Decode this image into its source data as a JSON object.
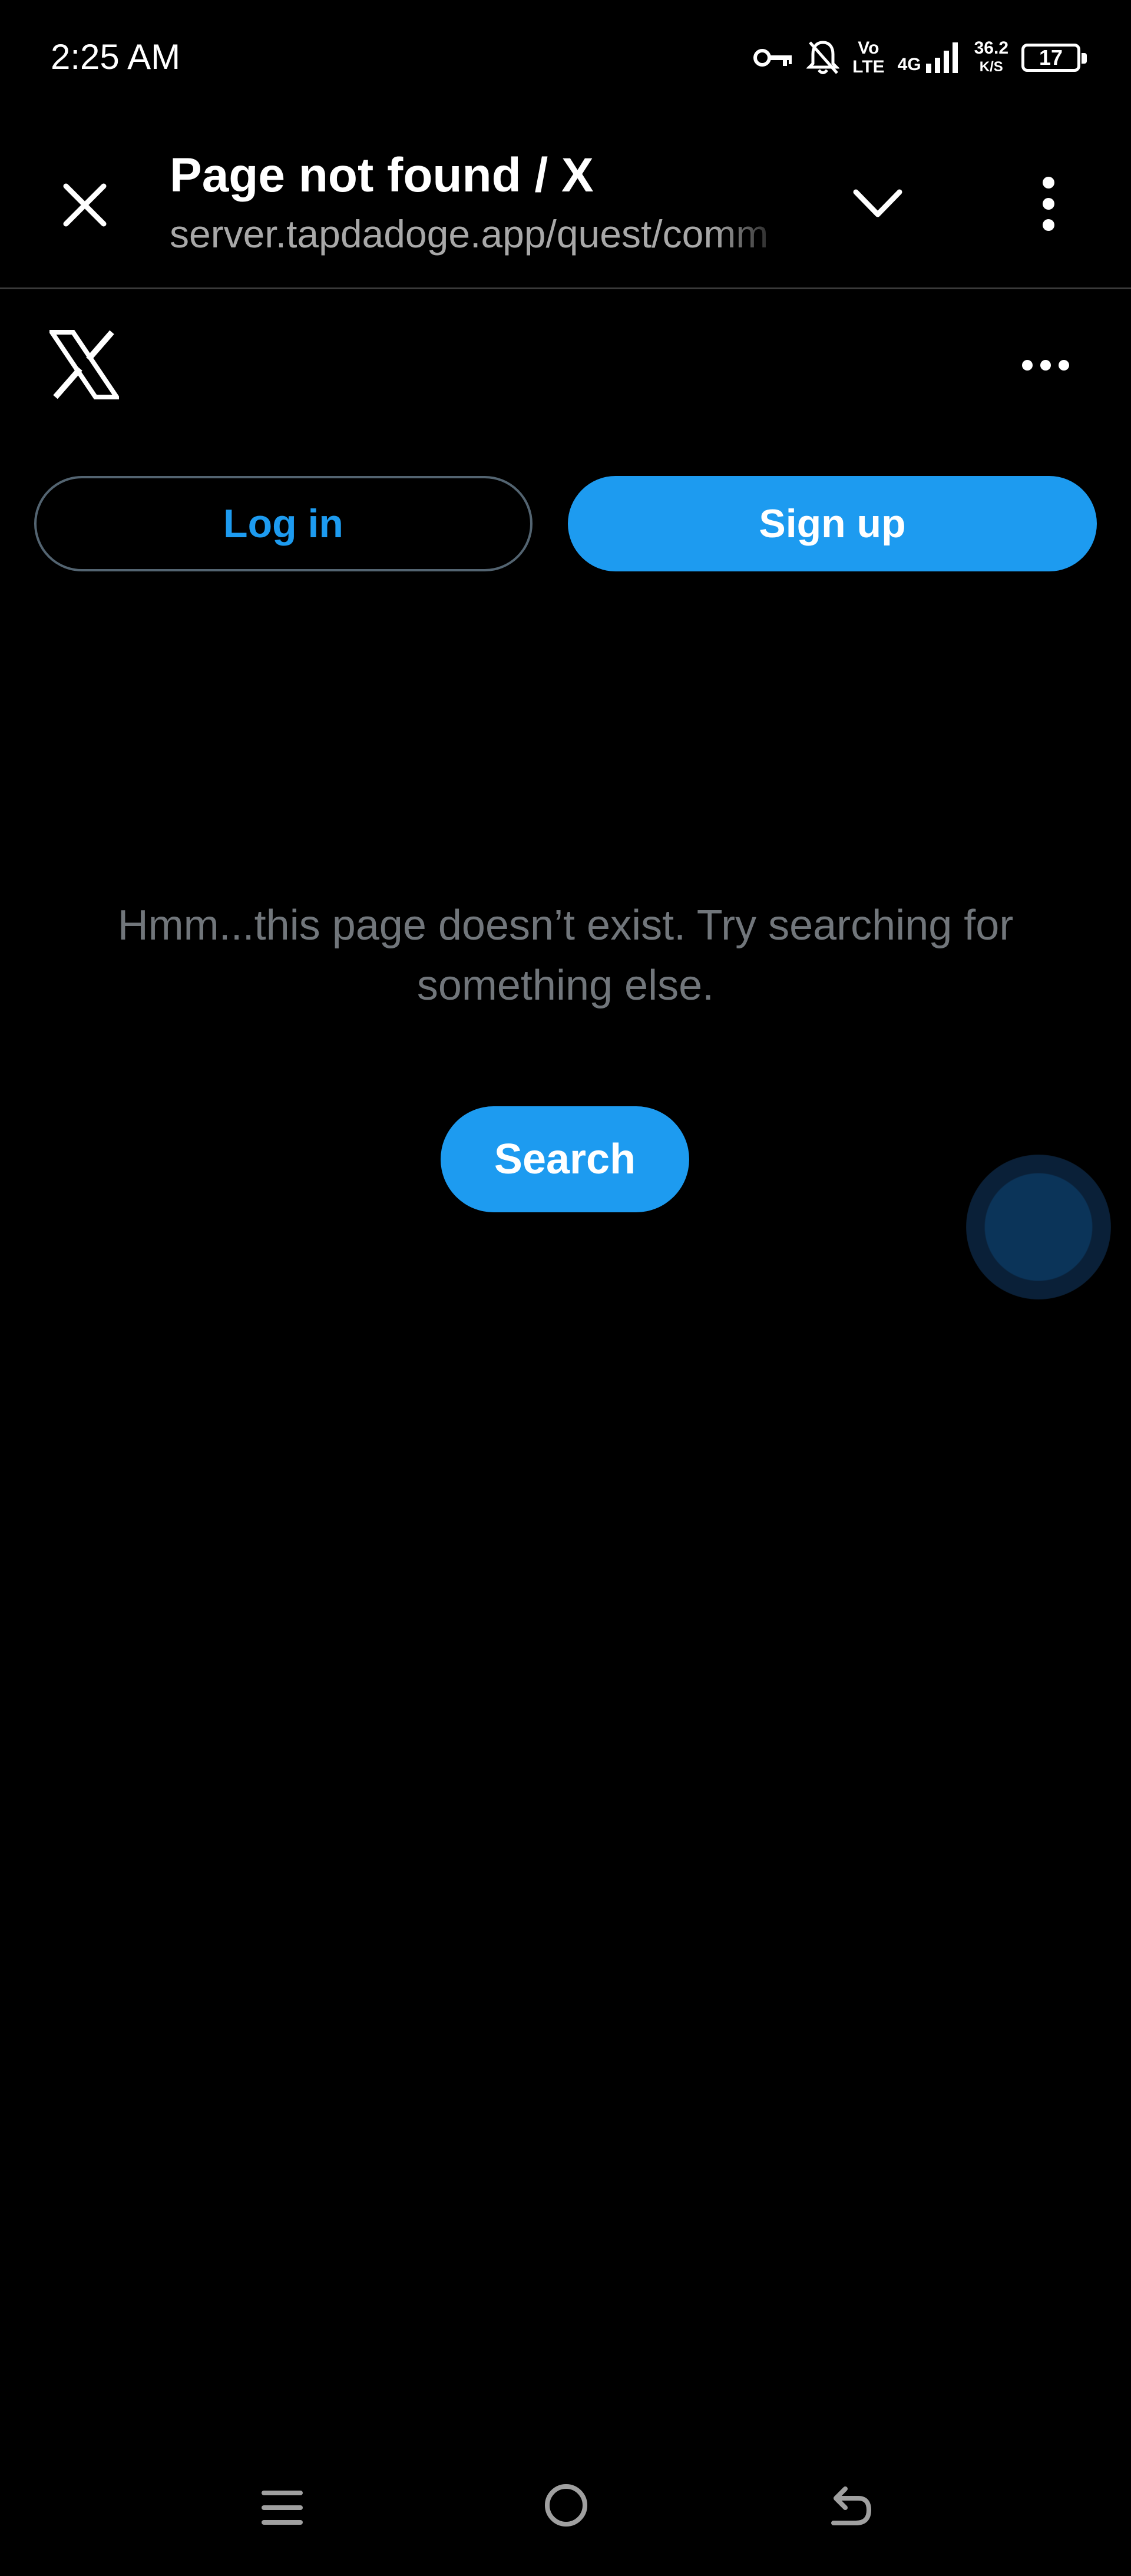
{
  "status_bar": {
    "time": "2:25 AM",
    "icons": [
      "vpn-key-icon",
      "notifications-off-icon",
      "volte-icon",
      "4g-signal-icon",
      "battery-icon"
    ],
    "volte_top": "Vo",
    "volte_bottom": "LTE",
    "network": "4G",
    "speed_value": "36.2",
    "speed_unit": "K/S",
    "battery": "17"
  },
  "browser_toolbar": {
    "title": "Page not found / X",
    "url": "server.tapdadoge.app/quest/comm"
  },
  "page": {
    "login_label": "Log in",
    "signup_label": "Sign up",
    "message": "Hmm...this page doesn’t exist. Try searching for something else.",
    "search_label": "Search"
  },
  "colors": {
    "accent": "#1d9bf0",
    "background": "#000000",
    "secondary_text": "#71767b"
  }
}
